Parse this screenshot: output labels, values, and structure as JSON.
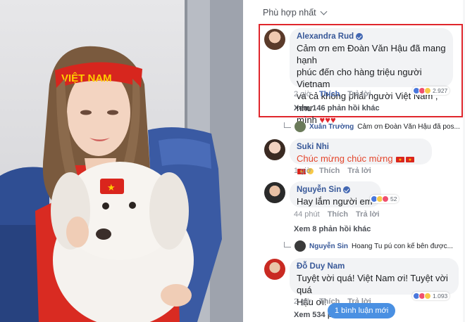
{
  "sort": {
    "label": "Phù hợp nhất"
  },
  "photo": {
    "headband_text": "VIỆT NAM",
    "flag_color": "#da251d",
    "star_color": "#ffcd00"
  },
  "comments": [
    {
      "author": "Alexandra Rud",
      "verified": true,
      "text_line1": "Cảm ơn em Đoàn Văn Hậu đã mang hạnh",
      "text_line2": "phúc đến cho hàng triệu người Vietnam",
      "text_line3": "và cả không phải người Việt Nam , như",
      "text_line4": "mình",
      "hearts": "♥♥♥",
      "time": "2 giờ",
      "like": "Thích",
      "reply": "Trả lời",
      "reactions": "2.927",
      "replies": "Xem 146 phản hồi khác",
      "sub_reply_author": "Xuân Trường",
      "sub_reply_text": "Cảm ơn Đoàn Văn Hậu đã pos..."
    },
    {
      "author": "Suki Nhi",
      "text": "Chúc mừng chúc mừng",
      "time": "1 giờ",
      "like": "Thích",
      "reply": "Trả lời"
    },
    {
      "author": "Nguyễn Sin",
      "verified": true,
      "text": "Hay lắm người em",
      "time": "44 phút",
      "like": "Thích",
      "reply": "Trả lời",
      "reactions": "52",
      "replies": "Xem 8 phản hồi khác",
      "sub_reply_author": "Nguyễn Sin",
      "sub_reply_text": "Hoang Tu pú con kế bên được..."
    },
    {
      "author": "Đỗ Duy Nam",
      "text_line1": "Tuyệt vời quá! Việt Nam ơi! Tuyệt vời quá",
      "text_line2": "Hậu ơi!",
      "time": "2 giờ",
      "like": "Thích",
      "reply": "Trả lời",
      "reactions": "1.093",
      "replies": "Xem 534 p"
    }
  ],
  "new_comment_button": "1 bình luận mới",
  "colors": {
    "link": "#385898",
    "highlight": "#e0262c",
    "accent": "#4a90e2"
  }
}
